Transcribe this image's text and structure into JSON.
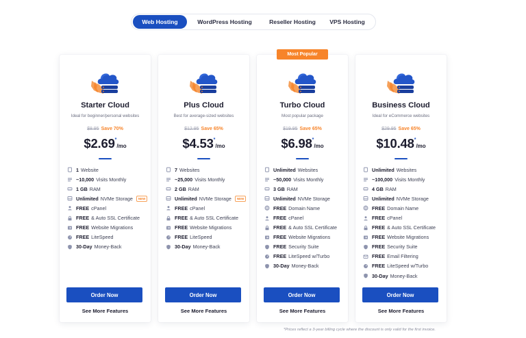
{
  "tabs": [
    {
      "label": "Web Hosting",
      "active": true
    },
    {
      "label": "WordPress Hosting",
      "active": false
    },
    {
      "label": "Reseller Hosting",
      "active": false
    },
    {
      "label": "VPS Hosting",
      "active": false
    }
  ],
  "colors": {
    "accent": "#1a4fc0",
    "highlight": "#f7842a",
    "text": "#1c1c2e"
  },
  "popular_badge": "Most Popular",
  "plans": [
    {
      "name": "Starter Cloud",
      "subtitle": "Ideal for beginner/personal websites",
      "old_price": "$8.95",
      "save": "Save 70%",
      "price": "$2.69",
      "asterisk": "*",
      "unit": "/mo",
      "features": [
        {
          "icon": "page-icon",
          "bold": "1",
          "text": "Website"
        },
        {
          "icon": "bars-icon",
          "bold": "~10,000",
          "text": "Visits Monthly"
        },
        {
          "icon": "ram-icon",
          "bold": "1 GB",
          "text": "RAM"
        },
        {
          "icon": "drive-icon",
          "bold": "Unlimited",
          "text": "NVMe Storage",
          "tag": "NEW"
        },
        {
          "icon": "user-icon",
          "bold": "FREE",
          "text": "cPanel"
        },
        {
          "icon": "lock-icon",
          "bold": "FREE",
          "text": "& Auto SSL Certificate"
        },
        {
          "icon": "migrate-icon",
          "bold": "FREE",
          "text": "Website Migrations"
        },
        {
          "icon": "speed-icon",
          "bold": "FREE",
          "text": "LiteSpeed"
        },
        {
          "icon": "shield-icon",
          "bold": "30-Day",
          "text": "Money-Back"
        }
      ],
      "order_label": "Order Now",
      "more_label": "See More Features"
    },
    {
      "name": "Plus Cloud",
      "subtitle": "Best for average-sized websites",
      "old_price": "$12.95",
      "save": "Save 65%",
      "price": "$4.53",
      "asterisk": "*",
      "unit": "/mo",
      "features": [
        {
          "icon": "page-icon",
          "bold": "7",
          "text": "Websites"
        },
        {
          "icon": "bars-icon",
          "bold": "~25,000",
          "text": "Visits Monthly"
        },
        {
          "icon": "ram-icon",
          "bold": "2 GB",
          "text": "RAM"
        },
        {
          "icon": "drive-icon",
          "bold": "Unlimited",
          "text": "NVMe Storage",
          "tag": "NEW"
        },
        {
          "icon": "user-icon",
          "bold": "FREE",
          "text": "cPanel"
        },
        {
          "icon": "lock-icon",
          "bold": "FREE",
          "text": "& Auto SSL Certificate"
        },
        {
          "icon": "migrate-icon",
          "bold": "FREE",
          "text": "Website Migrations"
        },
        {
          "icon": "speed-icon",
          "bold": "FREE",
          "text": "LiteSpeed"
        },
        {
          "icon": "shield-icon",
          "bold": "30-Day",
          "text": "Money-Back"
        }
      ],
      "order_label": "Order Now",
      "more_label": "See More Features"
    },
    {
      "name": "Turbo Cloud",
      "subtitle": "Most popular package",
      "old_price": "$19.95",
      "save": "Save 65%",
      "price": "$6.98",
      "asterisk": "*",
      "unit": "/mo",
      "features": [
        {
          "icon": "page-icon",
          "bold": "Unlimited",
          "text": "Websites"
        },
        {
          "icon": "bars-icon",
          "bold": "~50,000",
          "text": "Visits Monthly"
        },
        {
          "icon": "ram-icon",
          "bold": "3 GB",
          "text": "RAM"
        },
        {
          "icon": "drive-icon",
          "bold": "Unlimited",
          "text": "NVMe Storage"
        },
        {
          "icon": "globe-icon",
          "bold": "FREE",
          "text": "Domain Name"
        },
        {
          "icon": "user-icon",
          "bold": "FREE",
          "text": "cPanel"
        },
        {
          "icon": "lock-icon",
          "bold": "FREE",
          "text": "& Auto SSL Certificate"
        },
        {
          "icon": "migrate-icon",
          "bold": "FREE",
          "text": "Website Migrations"
        },
        {
          "icon": "shield-icon",
          "bold": "FREE",
          "text": "Security Suite"
        },
        {
          "icon": "speed-icon",
          "bold": "FREE",
          "text": "LiteSpeed w/Turbo"
        },
        {
          "icon": "shield-icon",
          "bold": "30-Day",
          "text": "Money-Back"
        }
      ],
      "order_label": "Order Now",
      "more_label": "See More Features"
    },
    {
      "name": "Business Cloud",
      "subtitle": "Ideal for eCommerce websites",
      "old_price": "$29.95",
      "save": "Save 65%",
      "price": "$10.48",
      "asterisk": "*",
      "unit": "/mo",
      "features": [
        {
          "icon": "page-icon",
          "bold": "Unlimited",
          "text": "Websites"
        },
        {
          "icon": "bars-icon",
          "bold": "~100,000",
          "text": "Visits Monthly"
        },
        {
          "icon": "ram-icon",
          "bold": "4 GB",
          "text": "RAM"
        },
        {
          "icon": "drive-icon",
          "bold": "Unlimited",
          "text": "NVMe Storage"
        },
        {
          "icon": "globe-icon",
          "bold": "FREE",
          "text": "Domain Name"
        },
        {
          "icon": "user-icon",
          "bold": "FREE",
          "text": "cPanel"
        },
        {
          "icon": "lock-icon",
          "bold": "FREE",
          "text": "& Auto SSL Certificate"
        },
        {
          "icon": "migrate-icon",
          "bold": "FREE",
          "text": "Website Migrations"
        },
        {
          "icon": "shield-icon",
          "bold": "FREE",
          "text": "Security Suite"
        },
        {
          "icon": "mail-icon",
          "bold": "FREE",
          "text": "Email Filtering"
        },
        {
          "icon": "speed-icon",
          "bold": "FREE",
          "text": "LiteSpeed w/Turbo"
        },
        {
          "icon": "shield-icon",
          "bold": "30-Day",
          "text": "Money-Back"
        }
      ],
      "order_label": "Order Now",
      "more_label": "See More Features"
    }
  ],
  "footnote": "*Prices reflect a 3-year billing cycle where the discount is only valid for the first invoice."
}
